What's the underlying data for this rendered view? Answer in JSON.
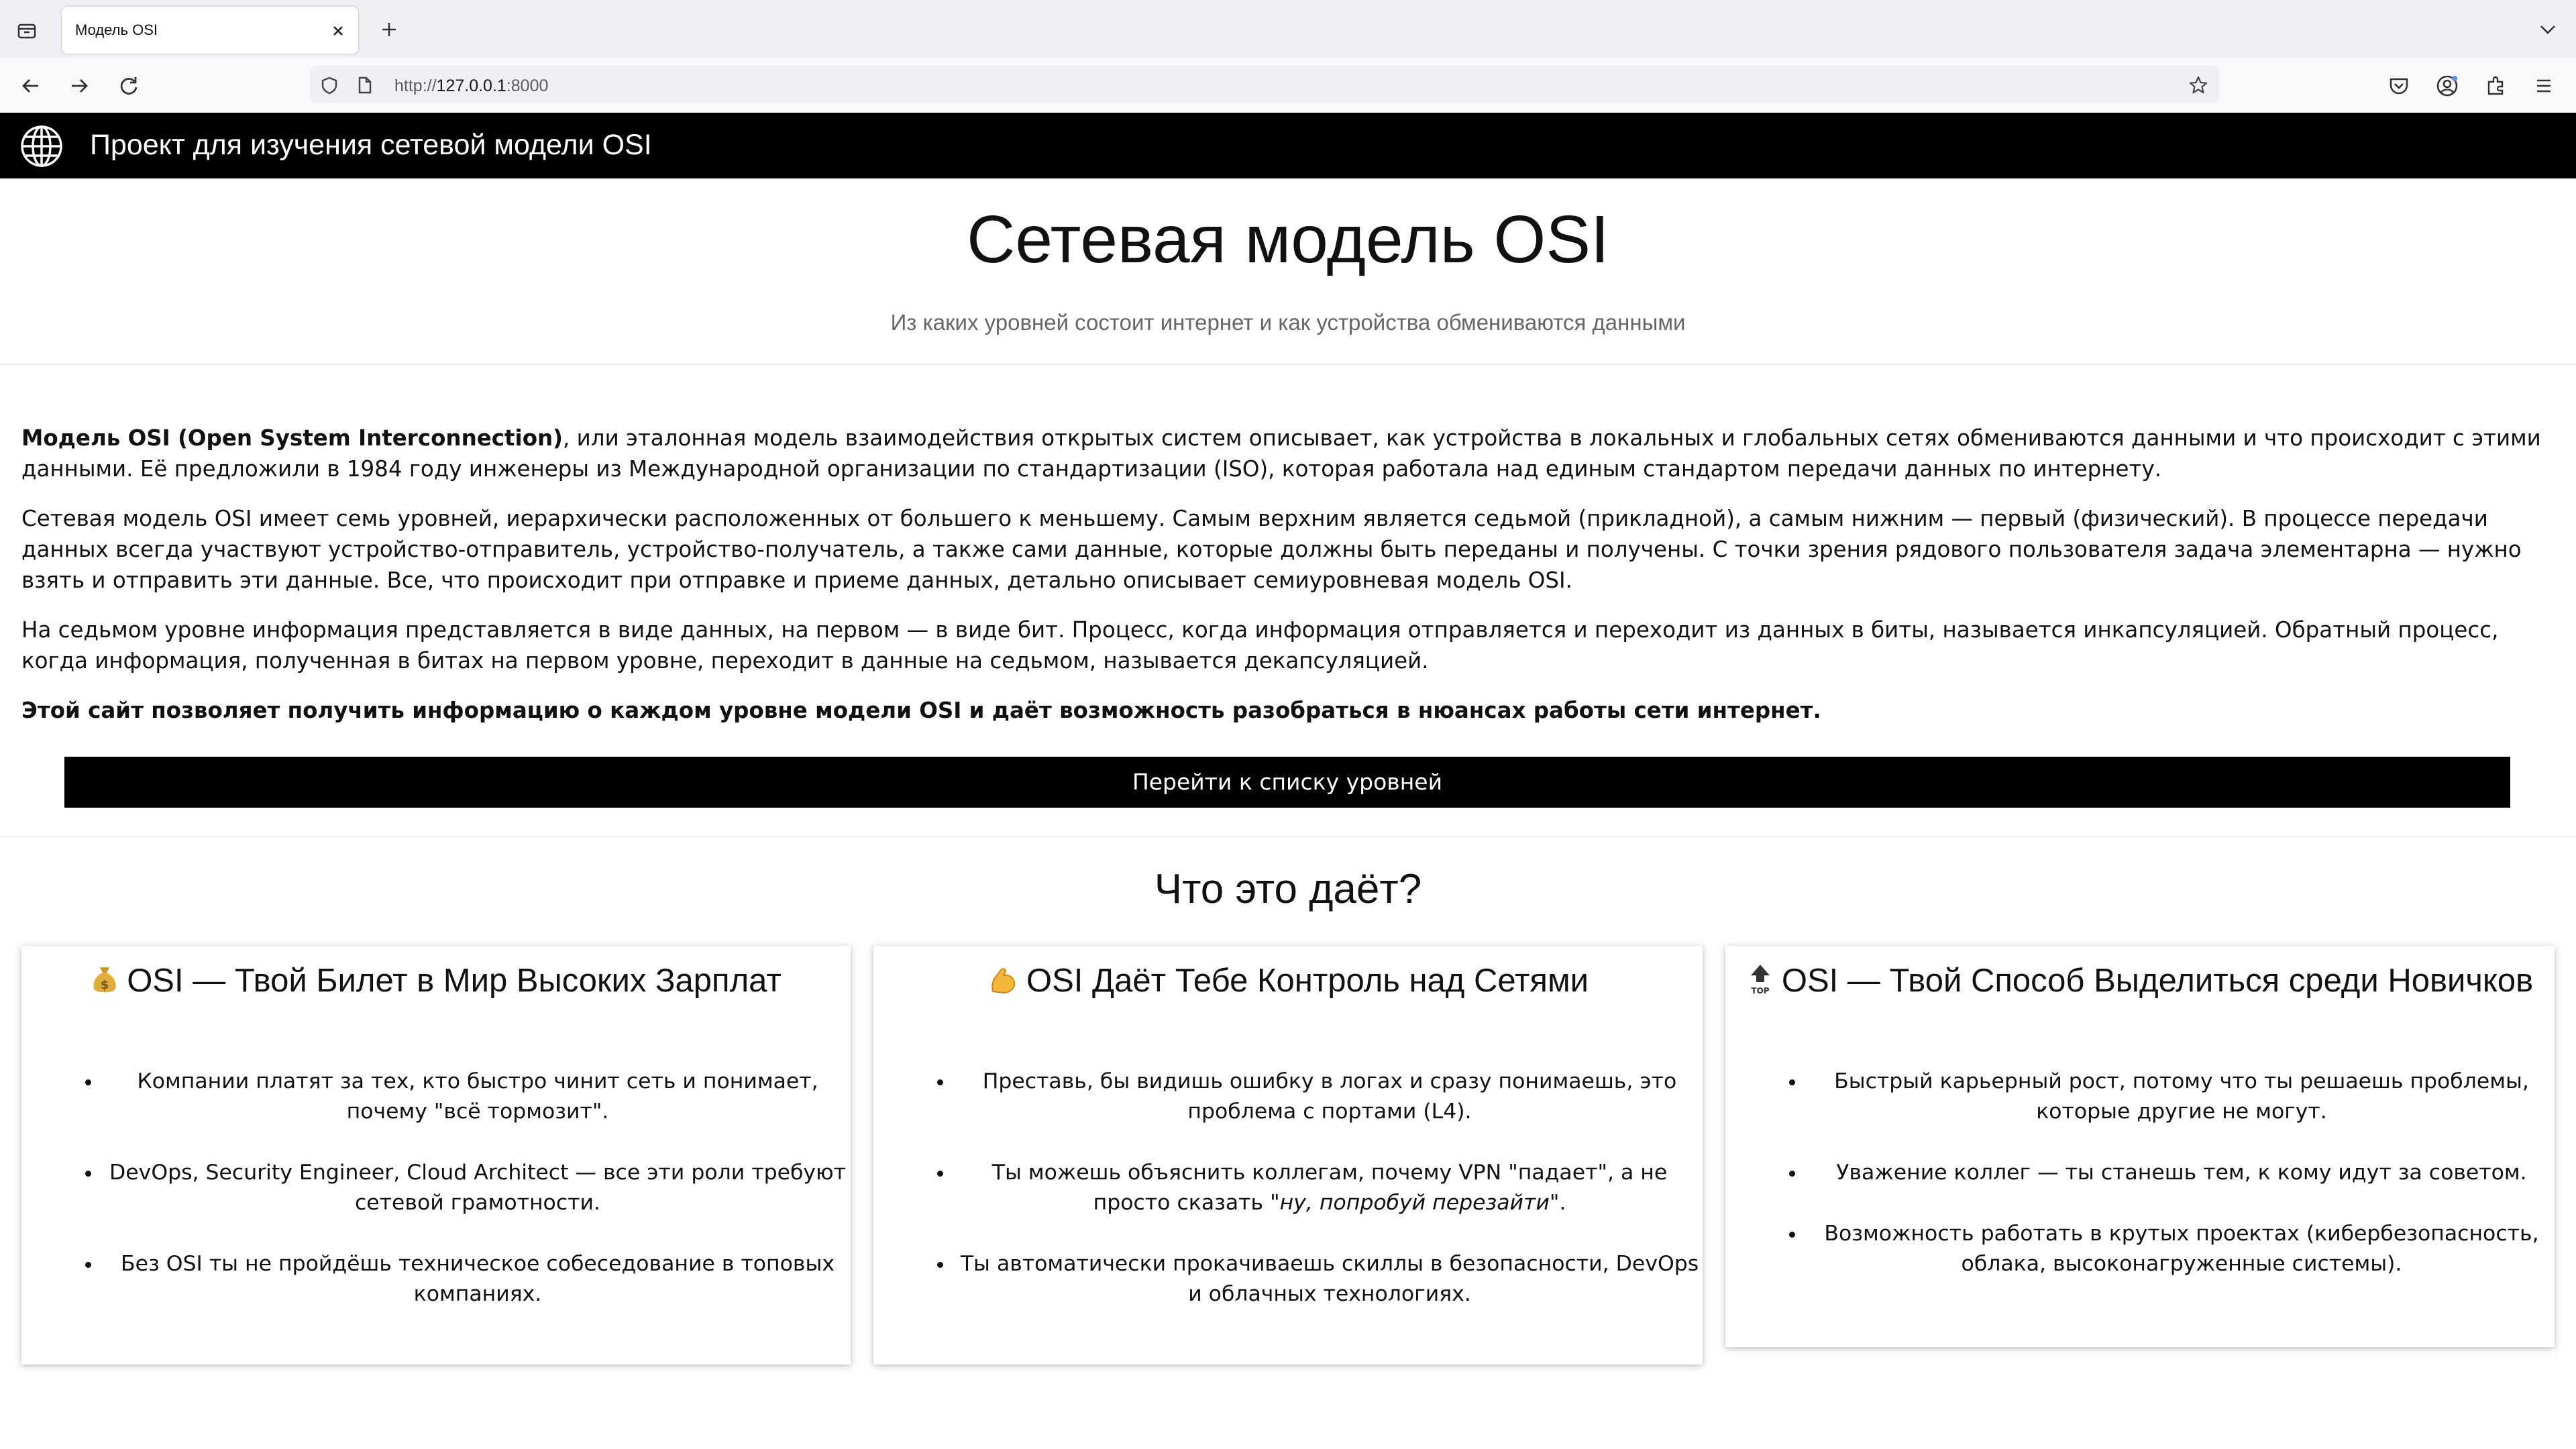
{
  "browser": {
    "tab_title": "Модель OSI",
    "url_prefix": "http://",
    "url_host": "127.0.0.1",
    "url_port": ":8000"
  },
  "site": {
    "header_title": "Проект для изучения сетевой модели OSI"
  },
  "hero": {
    "title": "Сетевая модель OSI",
    "subtitle": "Из каких уровней состоит интернет и как устройства обмениваются данными"
  },
  "intro": {
    "p1_bold": "Модель OSI (Open System Interconnection)",
    "p1_rest": ", или эталонная модель взаимодействия открытых систем описывает, как устройства в локальных и глобальных сетях обмениваются данными и что происходит с этими данными. Её предложили в 1984 году инженеры из Международной организации по стандартизации (ISO), которая работала над единым стандартом передачи данных по интернету.",
    "p2": "Сетевая модель OSI имеет семь уровней, иерархически расположенных от большего к меньшему. Самым верхним является седьмой (прикладной), а самым нижним — первый (физический). В процессе передачи данных всегда участвуют устройство-отправитель, устройство-получатель, а также сами данные, которые должны быть переданы и получены. С точки зрения рядового пользователя задача элементарна — нужно взять и отправить эти данные. Все, что происходит при отправке и приеме данных, детально описывает семиуровневая модель OSI.",
    "p3": "На седьмом уровне информация представляется в виде данных, на первом — в виде бит. Процесс, когда информация отправляется и переходит из данных в биты, называется инкапсуляцией. Обратный процесс, когда информация, полученная в битах на первом уровне, переходит в данные на седьмом, называется декапсуляцией.",
    "p4": "Этой сайт позволяет получить информацию о каждом уровне модели OSI и даёт возможность разобраться в нюансах работы сети интернет.",
    "cta_label": "Перейти к списку уровней"
  },
  "features": {
    "title": "Что это даёт?",
    "cards": [
      {
        "icon": "money-bag-icon",
        "title": "OSI — Твой Билет в Мир Высоких Зарплат",
        "items": [
          "Компании платят за тех, кто быстро чинит сеть и понимает, почему \"всё тормозит\".",
          "DevOps, Security Engineer, Cloud Architect — все эти роли требуют сетевой грамотности.",
          "Без OSI ты не пройдёшь техническое собеседование в топовых компаниях."
        ]
      },
      {
        "icon": "flexed-biceps-icon",
        "title": "OSI Даёт Тебе Контроль над Сетями",
        "items": [
          "Преставь, бы видишь ошибку в логах и сразу понимаешь, это проблема с портами (L4).",
          "Ты можешь объяснить коллегам, почему VPN \"падает\", а не просто сказать ",
          "Ты автоматически прокачиваешь скиллы в безопасности, DevOps и облачных технологиях."
        ],
        "item2_italic": "\"ну, попробуй перезайти\"",
        "item2_tail": "."
      },
      {
        "icon": "top-arrow-icon",
        "icon_text": "TOP",
        "title": "OSI — Твой Способ Выделиться среди Новичков",
        "items": [
          "Быстрый карьерный рост, потому что ты решаешь проблемы, которые другие не могут.",
          "Уважение коллег — ты станешь тем, к кому идут за советом.",
          "Возможность работать в крутых проектах (кибербезопасность, облака, высоконагруженные системы)."
        ]
      }
    ]
  }
}
